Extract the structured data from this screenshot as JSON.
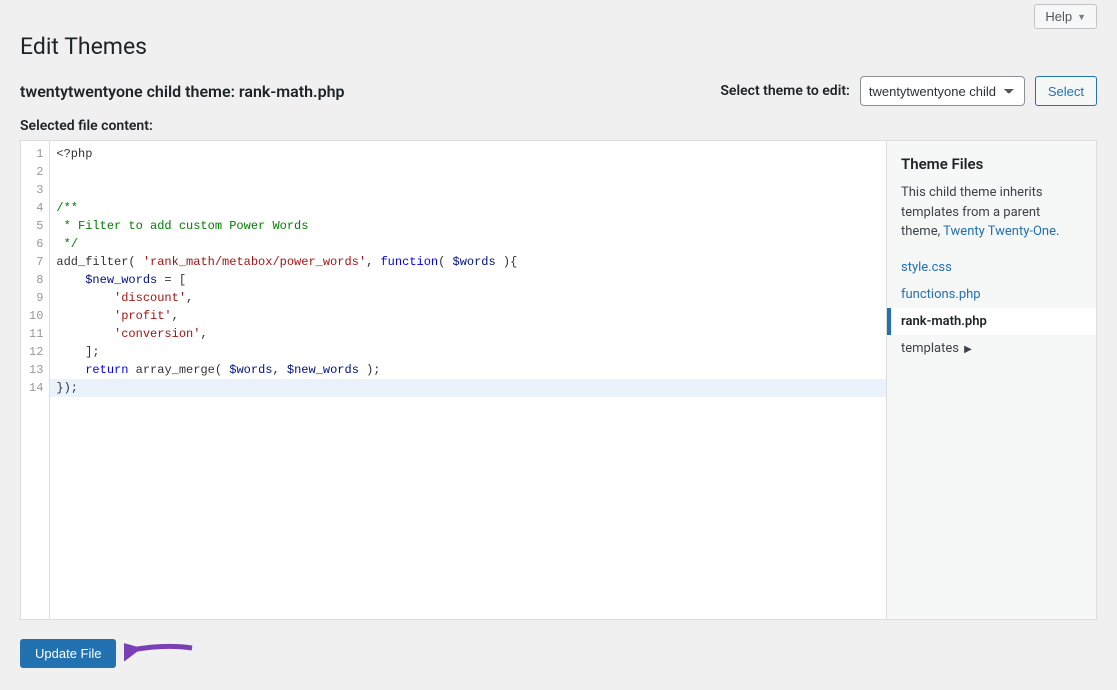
{
  "help_label": "Help",
  "page_title": "Edit Themes",
  "file_heading": "twentytwentyone child theme: rank-math.php",
  "theme_select_label": "Select theme to edit:",
  "theme_select_value": "twentytwentyone child",
  "select_button": "Select",
  "selected_file_label": "Selected file content:",
  "code_lines": [
    {
      "n": 1,
      "tokens": [
        {
          "t": "<?php",
          "c": ""
        }
      ]
    },
    {
      "n": 2,
      "tokens": []
    },
    {
      "n": 3,
      "tokens": []
    },
    {
      "n": 4,
      "tokens": [
        {
          "t": "/**",
          "c": "tok-com"
        }
      ]
    },
    {
      "n": 5,
      "tokens": [
        {
          "t": " * Filter to add custom Power Words",
          "c": "tok-com"
        }
      ]
    },
    {
      "n": 6,
      "tokens": [
        {
          "t": " */",
          "c": "tok-com"
        }
      ]
    },
    {
      "n": 7,
      "tokens": [
        {
          "t": "add_filter( ",
          "c": "tok-fn"
        },
        {
          "t": "'rank_math/metabox/power_words'",
          "c": "tok-str"
        },
        {
          "t": ", ",
          "c": ""
        },
        {
          "t": "function",
          "c": "tok-kw"
        },
        {
          "t": "( ",
          "c": ""
        },
        {
          "t": "$words",
          "c": "tok-var"
        },
        {
          "t": " ){",
          "c": ""
        }
      ]
    },
    {
      "n": 8,
      "tokens": [
        {
          "t": "    ",
          "c": ""
        },
        {
          "t": "$new_words",
          "c": "tok-var"
        },
        {
          "t": " = [",
          "c": ""
        }
      ]
    },
    {
      "n": 9,
      "tokens": [
        {
          "t": "        ",
          "c": ""
        },
        {
          "t": "'discount'",
          "c": "tok-str"
        },
        {
          "t": ",",
          "c": ""
        }
      ]
    },
    {
      "n": 10,
      "tokens": [
        {
          "t": "        ",
          "c": ""
        },
        {
          "t": "'profit'",
          "c": "tok-str"
        },
        {
          "t": ",",
          "c": ""
        }
      ]
    },
    {
      "n": 11,
      "tokens": [
        {
          "t": "        ",
          "c": ""
        },
        {
          "t": "'conversion'",
          "c": "tok-str"
        },
        {
          "t": ",",
          "c": ""
        }
      ]
    },
    {
      "n": 12,
      "tokens": [
        {
          "t": "    ];",
          "c": ""
        }
      ]
    },
    {
      "n": 13,
      "tokens": [
        {
          "t": "    ",
          "c": ""
        },
        {
          "t": "return",
          "c": "tok-kw"
        },
        {
          "t": " array_merge( ",
          "c": ""
        },
        {
          "t": "$words",
          "c": "tok-var"
        },
        {
          "t": ", ",
          "c": ""
        },
        {
          "t": "$new_words",
          "c": "tok-var"
        },
        {
          "t": " );",
          "c": ""
        }
      ]
    },
    {
      "n": 14,
      "tokens": [
        {
          "t": "});",
          "c": ""
        }
      ],
      "hl": true
    }
  ],
  "sidebar": {
    "heading": "Theme Files",
    "desc_prefix": "This child theme inherits templates from a parent theme, ",
    "parent_theme": "Twenty Twenty-One",
    "desc_suffix": ".",
    "files": [
      {
        "label": "style.css",
        "active": false
      },
      {
        "label": "functions.php",
        "active": false
      },
      {
        "label": "rank-math.php",
        "active": true
      },
      {
        "label": "templates",
        "folder": true
      }
    ]
  },
  "update_button": "Update File"
}
